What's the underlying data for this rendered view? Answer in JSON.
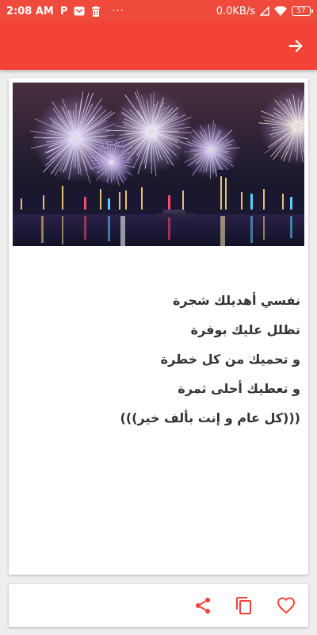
{
  "status_bar": {
    "time": "2:08 AM",
    "notification_icons": [
      "p-icon",
      "mail-icon",
      "trash-icon",
      "more-dots-icon"
    ],
    "network_speed": "0.0KB/s",
    "battery": "57"
  },
  "toolbar": {
    "forward_icon": "arrow-right-icon",
    "color": "#f44336"
  },
  "post": {
    "image": "fireworks-over-city-skyline-at-night",
    "lines": [
      "نفسي أهديلك شجرة",
      "تظلل عليك بوفرة",
      "و تحميك من كل خطرة",
      "و تعطيك أحلى ثمرة",
      "(((كل عام و إنت بألف خير)))"
    ]
  },
  "actions": {
    "accent_color": "#f44336",
    "icons": [
      "share-icon",
      "copy-icon",
      "favorite-icon"
    ]
  }
}
